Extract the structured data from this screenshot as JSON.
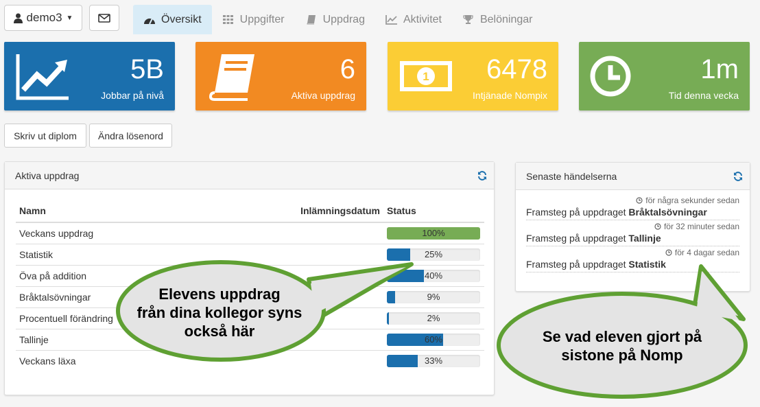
{
  "user": {
    "name": "demo3"
  },
  "nav": {
    "tabs": [
      {
        "label": "Översikt",
        "icon": "dashboard-icon",
        "active": true
      },
      {
        "label": "Uppgifter",
        "icon": "grid-icon"
      },
      {
        "label": "Uppdrag",
        "icon": "book-icon"
      },
      {
        "label": "Aktivitet",
        "icon": "line-chart-icon"
      },
      {
        "label": "Belöningar",
        "icon": "trophy-icon"
      }
    ]
  },
  "stats": [
    {
      "value": "5B",
      "label": "Jobbar på nivå",
      "color": "#1b6fad",
      "icon": "trend-chart-icon"
    },
    {
      "value": "6",
      "label": "Aktiva uppdrag",
      "color": "#f28a22",
      "icon": "book-icon"
    },
    {
      "value": "6478",
      "label": "Intjänade Nompix",
      "color": "#fbcd35",
      "icon": "money-icon"
    },
    {
      "value": "1m",
      "label": "Tid denna vecka",
      "color": "#77ac55",
      "icon": "clock-icon"
    }
  ],
  "actions": {
    "print_diploma": "Skriv ut diplom",
    "change_password": "Ändra lösenord"
  },
  "tasks_panel": {
    "title": "Aktiva uppdrag",
    "columns": {
      "name": "Namn",
      "date": "Inlämningsdatum",
      "status": "Status"
    },
    "rows": [
      {
        "name": "Veckans uppdrag",
        "date": "",
        "progress": 100,
        "progress_label": "100%"
      },
      {
        "name": "Statistik",
        "date": "",
        "progress": 25,
        "progress_label": "25%"
      },
      {
        "name": "Öva på addition",
        "date": "",
        "progress": 40,
        "progress_label": "40%"
      },
      {
        "name": "Bråktalsövningar",
        "date": "",
        "progress": 9,
        "progress_label": "9%"
      },
      {
        "name": "Procentuell förändring",
        "date": "",
        "progress": 2,
        "progress_label": "2%"
      },
      {
        "name": "Tallinje",
        "date": "",
        "progress": 60,
        "progress_label": "60%"
      },
      {
        "name": "Veckans läxa",
        "date": "",
        "progress": 33,
        "progress_label": "33%"
      }
    ]
  },
  "events_panel": {
    "title": "Senaste händelserna",
    "items": [
      {
        "time": "för några sekunder sedan",
        "prefix": "Framsteg på uppdraget",
        "target": "Bråktalsövningar"
      },
      {
        "time": "för 32 minuter sedan",
        "prefix": "Framsteg på uppdraget",
        "target": "Tallinje"
      },
      {
        "time": "för 4 dagar sedan",
        "prefix": "Framsteg på uppdraget",
        "target": "Statistik"
      }
    ]
  },
  "callouts": {
    "left": [
      "Elevens uppdrag",
      "från dina kollegor syns",
      "också här"
    ],
    "right": [
      "Se vad eleven gjort på",
      "sistone på Nomp"
    ]
  },
  "colors": {
    "primary": "#1b6fad",
    "orange": "#f28a22",
    "yellow": "#fbcd35",
    "green": "#77ac55",
    "callout_border": "#5fa033",
    "callout_fill": "#e4e4e4"
  }
}
